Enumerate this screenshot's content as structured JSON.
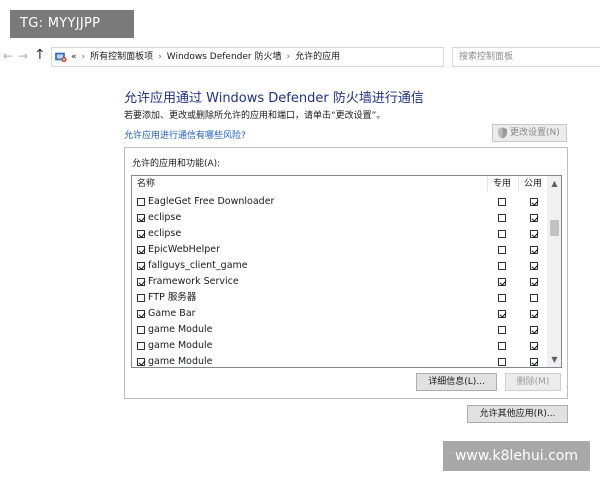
{
  "watermarks": {
    "top": "TG: MYYJJPP",
    "bottom": "www.k8lehui.com"
  },
  "nav": {
    "back_icon": "←",
    "forward_icon": "→",
    "up_icon": "↑",
    "breadcrumbs": [
      "«",
      "所有控制面板项",
      "Windows Defender 防火墙",
      "允许的应用"
    ],
    "refresh_icon": "↻",
    "dropdown_icon": "▾",
    "search_placeholder": "搜索控制面板"
  },
  "header": {
    "title": "允许应用通过 Windows Defender 防火墙进行通信",
    "subtitle": "若要添加、更改或删除所允许的应用和端口，请单击“更改设置”。",
    "risk_link": "允许应用进行通信有哪些风险?",
    "change_settings_label": "更改设置(N)"
  },
  "group": {
    "label": "允许的应用和功能(A):",
    "columns": {
      "name": "名称",
      "private": "专用",
      "public": "公用"
    },
    "rows": [
      {
        "name": "EagleGet Free Downloader",
        "enabled": false,
        "private": false,
        "public": true
      },
      {
        "name": "eclipse",
        "enabled": true,
        "private": false,
        "public": true
      },
      {
        "name": "eclipse",
        "enabled": true,
        "private": false,
        "public": true
      },
      {
        "name": "EpicWebHelper",
        "enabled": true,
        "private": false,
        "public": true
      },
      {
        "name": "fallguys_client_game",
        "enabled": true,
        "private": false,
        "public": true
      },
      {
        "name": "Framework Service",
        "enabled": true,
        "private": true,
        "public": true
      },
      {
        "name": "FTP 服务器",
        "enabled": false,
        "private": false,
        "public": false
      },
      {
        "name": "Game Bar",
        "enabled": true,
        "private": true,
        "public": true
      },
      {
        "name": "game Module",
        "enabled": false,
        "private": false,
        "public": true
      },
      {
        "name": "game Module",
        "enabled": false,
        "private": false,
        "public": true
      },
      {
        "name": "game Module",
        "enabled": true,
        "private": false,
        "public": true
      }
    ],
    "details_label": "详细信息(L)...",
    "delete_label": "删除(M)"
  },
  "allow_other_label": "允许其他应用(R)...",
  "colors": {
    "title": "#1e3287",
    "link": "#1d5ec2"
  }
}
